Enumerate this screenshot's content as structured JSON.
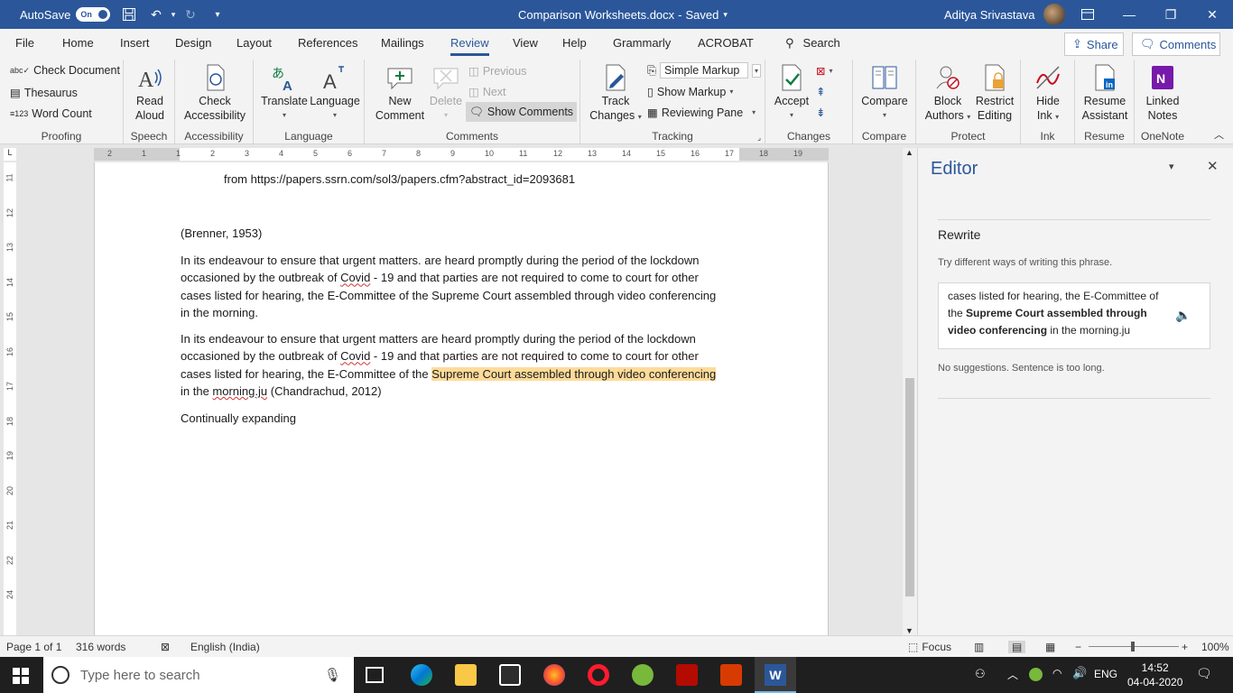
{
  "title_bar": {
    "autosave_label": "AutoSave",
    "autosave_state": "On",
    "document_title": "Comparison Worksheets.docx",
    "save_status": "Saved",
    "user_name": "Aditya Srivastava"
  },
  "menu": {
    "tabs": [
      "File",
      "Home",
      "Insert",
      "Design",
      "Layout",
      "References",
      "Mailings",
      "Review",
      "View",
      "Help",
      "Grammarly",
      "ACROBAT"
    ],
    "active_tab": "Review",
    "search_label": "Search",
    "share_label": "Share",
    "comments_label": "Comments"
  },
  "ribbon": {
    "proofing": {
      "label": "Proofing",
      "check_document": "Check Document",
      "thesaurus": "Thesaurus",
      "word_count": "Word Count"
    },
    "speech": {
      "label": "Speech",
      "read_aloud_1": "Read",
      "read_aloud_2": "Aloud"
    },
    "accessibility": {
      "label": "Accessibility",
      "check_1": "Check",
      "check_2": "Accessibility"
    },
    "language": {
      "label": "Language",
      "translate": "Translate",
      "language": "Language"
    },
    "comments": {
      "label": "Comments",
      "new_1": "New",
      "new_2": "Comment",
      "delete": "Delete",
      "previous": "Previous",
      "next": "Next",
      "show_comments": "Show Comments"
    },
    "tracking": {
      "label": "Tracking",
      "track_1": "Track",
      "track_2": "Changes",
      "markup_mode": "Simple Markup",
      "show_markup": "Show Markup",
      "reviewing_pane": "Reviewing Pane"
    },
    "changes": {
      "label": "Changes",
      "accept": "Accept"
    },
    "compare": {
      "label": "Compare",
      "compare": "Compare"
    },
    "protect": {
      "label": "Protect",
      "block_1": "Block",
      "block_2": "Authors",
      "restrict_1": "Restrict",
      "restrict_2": "Editing"
    },
    "ink": {
      "label": "Ink",
      "hide_1": "Hide",
      "hide_2": "Ink"
    },
    "resume": {
      "label": "Resume",
      "resume_1": "Resume",
      "resume_2": "Assistant"
    },
    "onenote": {
      "label": "OneNote",
      "linked_1": "Linked",
      "linked_2": "Notes"
    }
  },
  "document": {
    "ref_line": "from https://papers.ssrn.com/sol3/papers.cfm?abstract_id=2093681",
    "citation": "(Brenner, 1953)",
    "p1_a": "In its endeavour to ensure that urgent matters. are heard promptly during the period of the lockdown",
    "p1_b1": "occasioned by the outbreak of ",
    "p1_b2": "Covid",
    "p1_b3": " - 19 and that parties are not required to come to court for other",
    "p1_c": "cases listed for hearing, the E-Committee of the Supreme Court assembled through video conferencing",
    "p1_d": "in the morning.",
    "p2_a": "In its endeavour to ensure that urgent matters are heard promptly during the period of the lockdown",
    "p2_b1": "occasioned by the outbreak of ",
    "p2_b2": "Covid",
    "p2_b3": " - 19 and that parties are not required to come to court for other",
    "p2_c1": "cases listed for hearing, the E-Committee of the ",
    "p2_c2": "Supreme Court assembled through video conferencing",
    "p2_d1": "in the ",
    "p2_d2": "morning.ju",
    "p2_d3": " (Chandrachud, 2012)",
    "p3": "Continually expanding"
  },
  "editor_pane": {
    "title": "Editor",
    "section": "Rewrite",
    "hint": "Try different ways of writing this phrase.",
    "box_line1": "cases listed for hearing, the E-Committee of",
    "box_line2_a": "the ",
    "box_line2_b": "Supreme Court assembled through",
    "box_line3_a": "video conferencing",
    "box_line3_b": " in the morning.ju",
    "no_suggestions": "No suggestions. Sentence is too long."
  },
  "status_bar": {
    "page": "Page 1 of 1",
    "words": "316 words",
    "language": "English (India)",
    "focus": "Focus",
    "zoom": "100%"
  },
  "taskbar": {
    "search_placeholder": "Type here to search",
    "lang": "ENG",
    "time": "14:52",
    "date": "04-04-2020"
  },
  "ruler": {
    "h_ticks": [
      "2",
      "1",
      "1",
      "2",
      "3",
      "4",
      "5",
      "6",
      "7",
      "8",
      "9",
      "10",
      "11",
      "12",
      "13",
      "14",
      "15",
      "16",
      "17",
      "18",
      "19"
    ],
    "v_ticks": [
      "11",
      "12",
      "13",
      "14",
      "15",
      "16",
      "17",
      "18",
      "19",
      "20",
      "21",
      "22",
      "24"
    ],
    "corner": "L"
  },
  "colors": {
    "accent": "#2b579a",
    "highlight": "#fddb9a",
    "spelling_squiggle": "#d13438"
  }
}
